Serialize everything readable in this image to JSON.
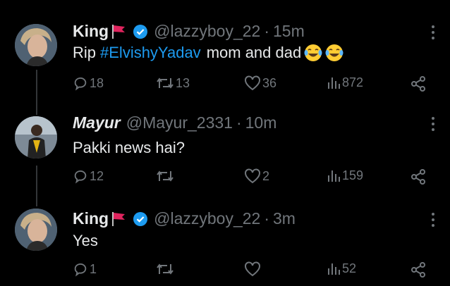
{
  "tweets": [
    {
      "name": "King",
      "handle": "@lazzyboy_22",
      "time": "15m",
      "verified": true,
      "text_prefix": "Rip",
      "hashtag": "#ElvishyYadav",
      "text_suffix": "mom and dad",
      "emoji": [
        "face-with-tears-of-joy",
        "face-with-tears-of-joy"
      ],
      "stats": {
        "replies": "18",
        "retweets": "13",
        "likes": "36",
        "views": "872"
      }
    },
    {
      "name": "Mayur",
      "handle": "@Mayur_2331",
      "time": "10m",
      "verified": false,
      "text": "Pakki news hai?",
      "stats": {
        "replies": "12",
        "retweets": "",
        "likes": "2",
        "views": "159"
      }
    },
    {
      "name": "King",
      "handle": "@lazzyboy_22",
      "time": "3m",
      "verified": true,
      "text": "Yes",
      "stats": {
        "replies": "1",
        "retweets": "",
        "likes": "",
        "views": "52"
      }
    }
  ],
  "colors": {
    "background": "#000000",
    "text": "#e7e9ea",
    "muted": "#71767b",
    "accent": "#1d9bf0",
    "flag": "#e0245e"
  },
  "separator": "·"
}
